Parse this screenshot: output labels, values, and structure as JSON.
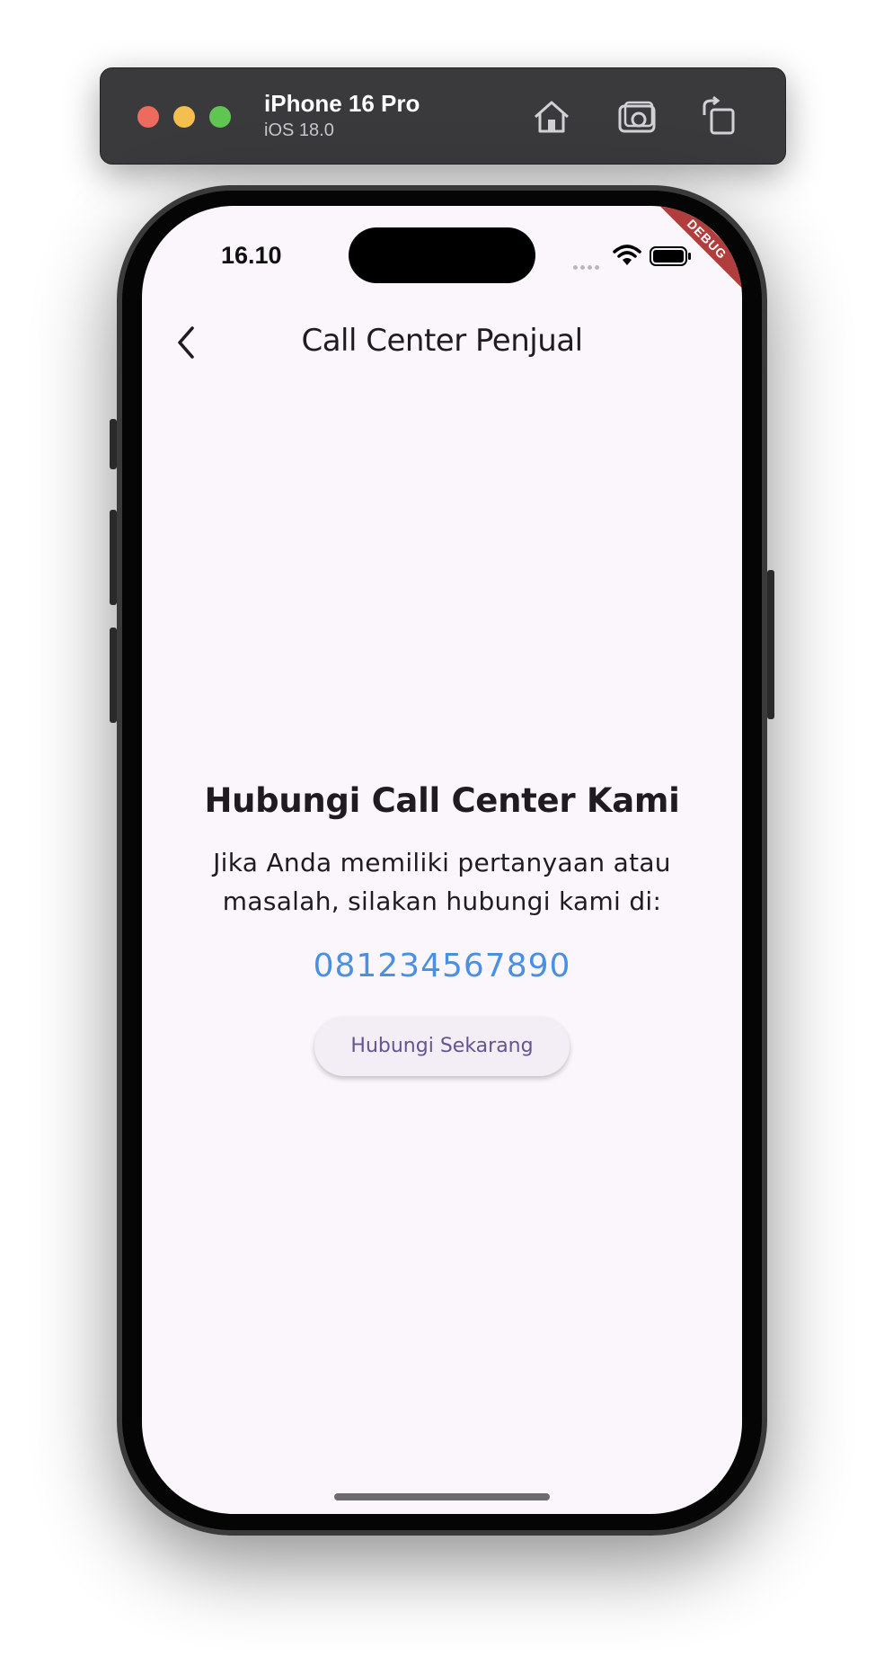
{
  "simulator": {
    "device_name": "iPhone 16 Pro",
    "os_version": "iOS 18.0",
    "toolbar_icons": [
      "home-icon",
      "screenshot-icon",
      "rotate-icon"
    ]
  },
  "status_bar": {
    "time": "16.10",
    "debug_label": "DEBUG"
  },
  "app_bar": {
    "title": "Call Center Penjual",
    "back_icon": "chevron-left-icon"
  },
  "main": {
    "heading": "Hubungi Call Center Kami",
    "description": "Jika Anda memiliki pertanyaan atau masalah, silakan hubungi kami di:",
    "phone_number": "081234567890",
    "call_button_label": "Hubungi Sekarang"
  },
  "colors": {
    "background": "#fbf6fb",
    "phone_link": "#4a90e2",
    "button_text": "#65558f",
    "debug_banner": "#b13d3d"
  }
}
